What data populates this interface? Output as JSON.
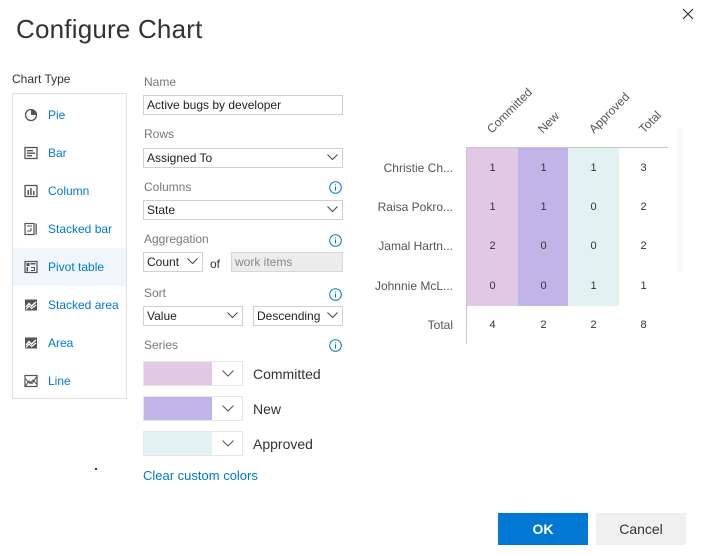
{
  "dialog": {
    "title": "Configure Chart",
    "close_icon": "close-icon"
  },
  "chart_type": {
    "label": "Chart Type",
    "selected": "Pivot table",
    "items": [
      {
        "label": "Pie",
        "icon": "pie-chart-icon"
      },
      {
        "label": "Bar",
        "icon": "bar-chart-icon"
      },
      {
        "label": "Column",
        "icon": "column-chart-icon"
      },
      {
        "label": "Stacked bar",
        "icon": "stacked-bar-icon"
      },
      {
        "label": "Pivot table",
        "icon": "pivot-table-icon"
      },
      {
        "label": "Stacked area",
        "icon": "stacked-area-icon"
      },
      {
        "label": "Area",
        "icon": "area-chart-icon"
      },
      {
        "label": "Line",
        "icon": "line-chart-icon"
      }
    ]
  },
  "form": {
    "name_label": "Name",
    "name_value": "Active bugs by developer",
    "rows_label": "Rows",
    "rows_value": "Assigned To",
    "columns_label": "Columns",
    "columns_value": "State",
    "aggregation_label": "Aggregation",
    "aggregation_value": "Count",
    "of_label": "of",
    "aggregation_field": "work items",
    "sort_label": "Sort",
    "sort_by": "Value",
    "sort_order": "Descending",
    "series_label": "Series",
    "series": [
      {
        "name": "Committed",
        "color": "#e1c9e6"
      },
      {
        "name": "New",
        "color": "#c0b4e8"
      },
      {
        "name": "Approved",
        "color": "#e2f2f2"
      }
    ],
    "clear_colors_label": "Clear custom colors"
  },
  "pivot": {
    "columns": [
      "Committed",
      "New",
      "Approved",
      "Total"
    ],
    "rows": [
      {
        "label": "Christie Ch...",
        "values": [
          1,
          1,
          1,
          3
        ]
      },
      {
        "label": "Raisa Pokro...",
        "values": [
          1,
          1,
          0,
          2
        ]
      },
      {
        "label": "Jamal Hartn...",
        "values": [
          2,
          0,
          0,
          2
        ]
      },
      {
        "label": "Johnnie McL...",
        "values": [
          0,
          0,
          1,
          1
        ]
      }
    ],
    "total_row": {
      "label": "Total",
      "values": [
        4,
        2,
        2,
        8
      ]
    }
  },
  "chart_data": {
    "type": "table",
    "title": "Active bugs by developer",
    "columns": [
      "Committed",
      "New",
      "Approved",
      "Total"
    ],
    "rows": [
      "Christie Ch...",
      "Raisa Pokro...",
      "Jamal Hartn...",
      "Johnnie McL...",
      "Total"
    ],
    "values": [
      [
        1,
        1,
        1,
        3
      ],
      [
        1,
        1,
        0,
        2
      ],
      [
        2,
        0,
        0,
        2
      ],
      [
        0,
        0,
        1,
        1
      ],
      [
        4,
        2,
        2,
        8
      ]
    ]
  },
  "buttons": {
    "ok": "OK",
    "cancel": "Cancel"
  }
}
